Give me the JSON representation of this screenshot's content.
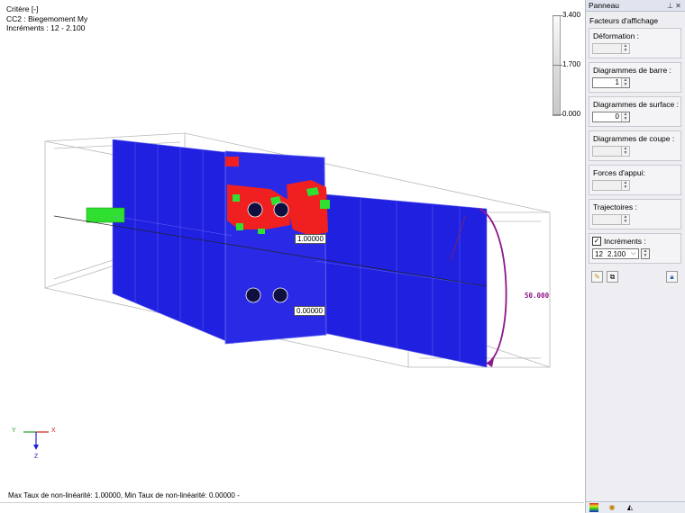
{
  "viewport": {
    "info_lines": [
      "Critère [-]",
      "CC2 : Biegemoment My",
      "Incréments : 12 - 2.100"
    ],
    "scale": {
      "max": "3.400",
      "mid": "1.700",
      "min": "0.000"
    },
    "result_labels": {
      "upper": "1.00000",
      "lower": "0.00000",
      "moment": "50.000"
    },
    "axes": {
      "x": "X",
      "y": "Y",
      "z": "Z"
    },
    "status_text": "Max Taux de non-linéarité: 1.00000, Min Taux de non-linéarité: 0.00000 -"
  },
  "panel": {
    "title": "Panneau",
    "pin_icon": "pin-icon",
    "close_icon": "close-icon",
    "subtitle": "Facteurs d'affichage",
    "groups": [
      {
        "label": "Déformation :",
        "value": "",
        "enabled": false
      },
      {
        "label": "Diagrammes de barre :",
        "value": "1",
        "enabled": true
      },
      {
        "label": "Diagrammes de surface :",
        "value": "0",
        "enabled": true
      },
      {
        "label": "Diagrammes de coupe :",
        "value": "",
        "enabled": false
      },
      {
        "label": "Forces d'appui:",
        "value": "",
        "enabled": false
      },
      {
        "label": "Trajectoires :",
        "value": "",
        "enabled": false
      }
    ],
    "increments": {
      "label": "Incréments :",
      "checked": true,
      "number": "12",
      "value": "2.100"
    },
    "tool_icons": [
      "edit-icon",
      "copy-icon",
      "lock-icon"
    ],
    "footer_icons": [
      "color-scale-icon",
      "display-icon",
      "view-icon"
    ]
  },
  "colors": {
    "blue": "#2020e0",
    "red": "#f02020",
    "green": "#30e030",
    "purple": "#8c168c"
  }
}
